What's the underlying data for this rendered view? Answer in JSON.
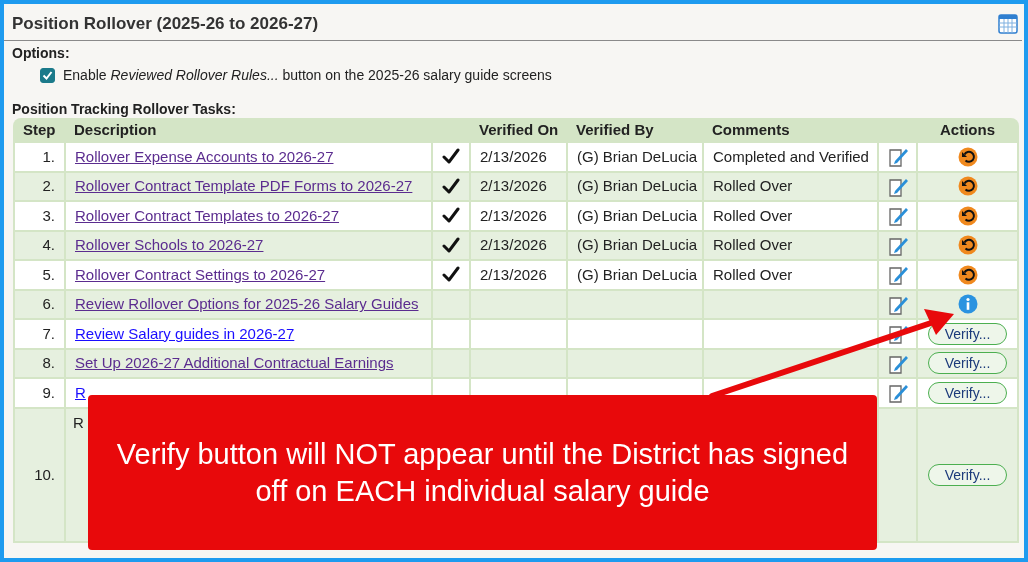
{
  "panel": {
    "title": "Position Rollover (2025-26 to 2026-27)"
  },
  "options": {
    "heading": "Options:",
    "items": [
      {
        "label": "Enable *Reviewed Rollover Rules...* button on the 2025-26 salary guide screens",
        "checked": true
      }
    ]
  },
  "tasks": {
    "heading": "Position Tracking Rollover Tasks:",
    "columns": [
      "Step",
      "Description",
      "Verified On",
      "Verified By",
      "Comments",
      "Actions"
    ],
    "rows": [
      {
        "step": "1.",
        "kind": "link",
        "description": "Rollover Expense Accounts to 2026-27",
        "visited": true,
        "verified": true,
        "verified_on": "2/13/2026",
        "verified_by": "(G) Brian DeLucia",
        "comments": "Completed and Verified",
        "edit": true,
        "action": {
          "kind": "undo"
        }
      },
      {
        "step": "2.",
        "kind": "link",
        "description": "Rollover Contract Template PDF Forms to 2026-27",
        "visited": true,
        "verified": true,
        "verified_on": "2/13/2026",
        "verified_by": "(G) Brian DeLucia",
        "comments": "Rolled Over",
        "edit": true,
        "action": {
          "kind": "undo"
        }
      },
      {
        "step": "3.",
        "kind": "link",
        "description": "Rollover Contract Templates to 2026-27",
        "visited": true,
        "verified": true,
        "verified_on": "2/13/2026",
        "verified_by": "(G) Brian DeLucia",
        "comments": "Rolled Over",
        "edit": true,
        "action": {
          "kind": "undo"
        }
      },
      {
        "step": "4.",
        "kind": "link",
        "description": "Rollover Schools to 2026-27",
        "visited": true,
        "verified": true,
        "verified_on": "2/13/2026",
        "verified_by": "(G) Brian DeLucia",
        "comments": "Rolled Over",
        "edit": true,
        "action": {
          "kind": "undo"
        }
      },
      {
        "step": "5.",
        "kind": "link",
        "description": "Rollover Contract Settings to 2026-27",
        "visited": true,
        "verified": true,
        "verified_on": "2/13/2026",
        "verified_by": "(G) Brian DeLucia",
        "comments": "Rolled Over",
        "edit": true,
        "action": {
          "kind": "undo"
        }
      },
      {
        "step": "6.",
        "kind": "link",
        "description": "Review Rollover Options for 2025-26 Salary Guides",
        "visited": true,
        "verified": false,
        "edit": true,
        "action": {
          "kind": "info"
        }
      },
      {
        "step": "7.",
        "kind": "link",
        "description": "Review Salary guides in 2026-27",
        "visited": false,
        "verified": false,
        "edit": true,
        "action": {
          "kind": "verify",
          "label": "Verify..."
        }
      },
      {
        "step": "8.",
        "kind": "link",
        "description": "Set Up 2026-27 Additional Contractual Earnings",
        "visited": true,
        "verified": false,
        "edit": true,
        "action": {
          "kind": "verify",
          "label": "Verify..."
        }
      },
      {
        "step": "9.",
        "kind": "link",
        "description": "R",
        "visited": false,
        "verified": false,
        "edit": true,
        "action": {
          "kind": "verify",
          "label": "Verify..."
        }
      },
      {
        "step": "10.",
        "kind": "text",
        "description": "R",
        "edit": false,
        "action": {
          "kind": "verify",
          "label": "Verify..."
        }
      }
    ]
  },
  "callout": {
    "text": "Verify button will NOT appear until the District has signed off on EACH individual salary guide"
  }
}
